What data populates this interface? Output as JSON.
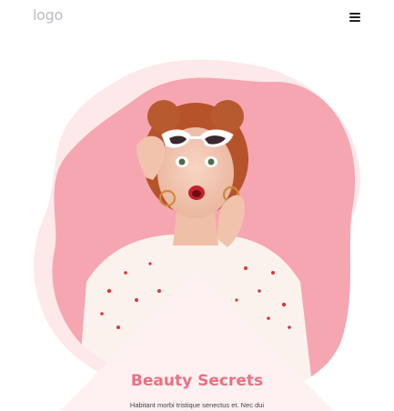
{
  "header": {
    "logo_text": "logo",
    "menu_icon": "hamburger-menu-icon"
  },
  "hero": {
    "image_subject": "surprised red-haired woman in white cat-eye sunglasses",
    "blob_color": "#f6a6b0",
    "blob_back_color": "#fde8ea"
  },
  "content": {
    "heading": "Beauty Secrets",
    "subtext": "Habitant morbi tristique senectus et. Nec dui"
  },
  "colors": {
    "accent": "#ec6f80",
    "logo": "#b9bcc2",
    "triangle": "#fff1f2"
  }
}
